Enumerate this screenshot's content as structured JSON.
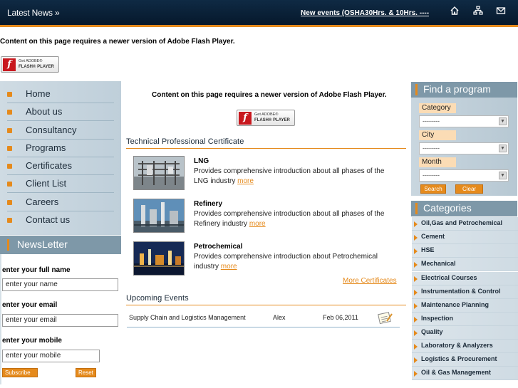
{
  "header": {
    "latest_news": "Latest News",
    "latest_arrows": "»",
    "ticker_text": "New events (OSHA30Hrs. & 10Hrs. ---- (",
    "icons": [
      "home-icon",
      "sitemap-icon",
      "mail-icon"
    ]
  },
  "flash": {
    "message": "Content on this page requires a newer version of Adobe Flash Player.",
    "badge_line1": "Get ADOBE®",
    "badge_line2": "FLASH® PLAYER",
    "badge_glyph": "f"
  },
  "leftnav": {
    "items": [
      {
        "label": "Home"
      },
      {
        "label": "About us"
      },
      {
        "label": "Consultancy"
      },
      {
        "label": "Programs"
      },
      {
        "label": "Certificates"
      },
      {
        "label": "Client List"
      },
      {
        "label": "Careers"
      },
      {
        "label": "Contact us"
      }
    ]
  },
  "newsletter": {
    "title": "NewsLetter",
    "name_label": "enter your full name",
    "name_value": "enter your name",
    "email_label": "enter your email",
    "email_value": "enter your email",
    "mobile_label": "enter your mobile",
    "mobile_value": "enter your mobile",
    "subscribe": "Subscribe",
    "reset": "Reset"
  },
  "certificates": {
    "title": "Technical Professional Certificate",
    "items": [
      {
        "name": "LNG",
        "desc": "Provides comprehensive introduction about all phases of the LNG industry",
        "more": "more"
      },
      {
        "name": "Refinery",
        "desc": "Provides comprehensive introduction about all phases of the Refinery industry",
        "more": "more"
      },
      {
        "name": "Petrochemical",
        "desc": "Provides comprehensive introduction about Petrochemical industry",
        "more": "more"
      }
    ],
    "more_link": "More Certificates"
  },
  "events": {
    "title": "Upcoming Events",
    "rows": [
      {
        "name": "Supply Chain and Logistics Management",
        "person": "Alex",
        "date": "Feb 06,2011"
      }
    ]
  },
  "finder": {
    "title": "Find a program",
    "category_label": "Category",
    "category_value": "--------",
    "city_label": "City",
    "city_value": "--------",
    "month_label": "Month",
    "month_value": "--------",
    "search": "Search",
    "clear": "Clear"
  },
  "categories": {
    "title": "Categories",
    "items": [
      "Oil,Gas and Petrochemical",
      "Cement",
      "HSE",
      "Mechanical",
      "Electrical Courses",
      "Instrumentation & Control",
      "Maintenance Planning",
      "Inspection",
      "Quality",
      "Laboratory & Analyzers",
      "Logistics & Procurement",
      "Oil & Gas Management"
    ]
  },
  "colors": {
    "accent": "#e58a1c",
    "header": "#0f2a44",
    "panel": "#7e98a8"
  }
}
